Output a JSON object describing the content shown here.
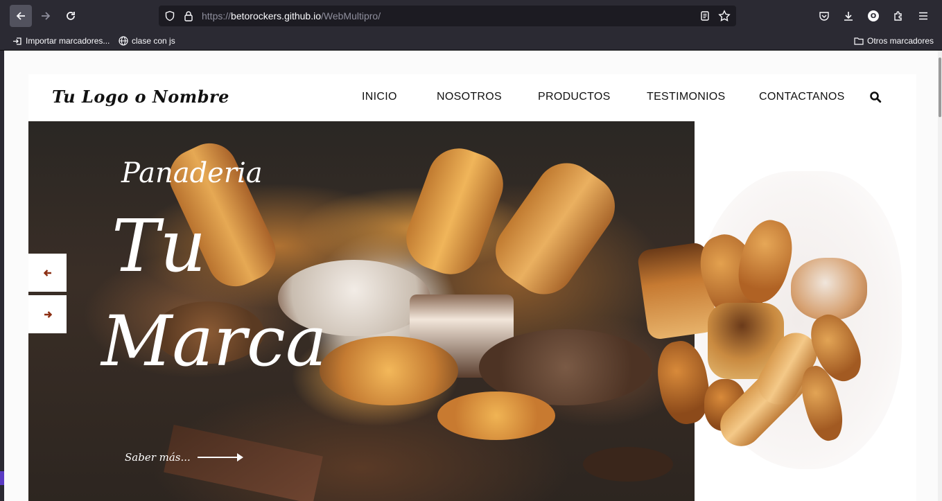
{
  "browser": {
    "url_prefix": "https://",
    "url_host": "betorockers.github.io",
    "url_path": "/WebMultipro/",
    "bookmarks": [
      {
        "label": "Importar marcadores..."
      },
      {
        "label": "clase con js"
      }
    ],
    "other_bookmarks": "Otros marcadores",
    "profile_initial": "O"
  },
  "site": {
    "logo": "Tu Logo o Nombre",
    "nav": [
      "INICIO",
      "NOSOTROS",
      "PRODUCTOS",
      "TESTIMONIOS",
      "CONTACTANOS"
    ]
  },
  "hero": {
    "subtitle": "Panaderia",
    "title_line1": "Tu",
    "title_line2": "Marca",
    "cta": "Saber más...",
    "accent_color": "#8b2e12"
  }
}
